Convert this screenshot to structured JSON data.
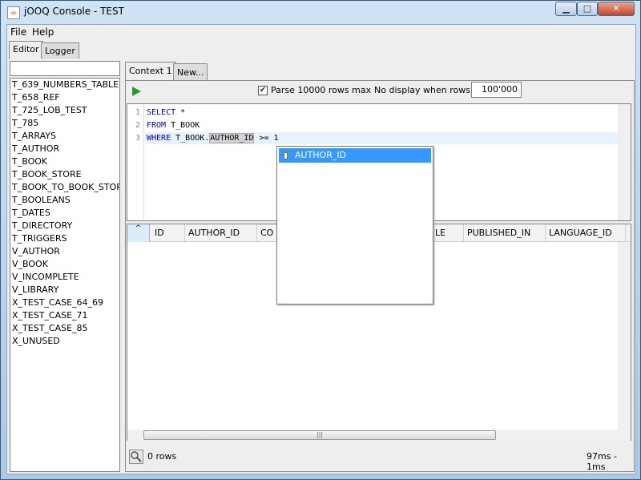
{
  "window": {
    "title": "jOOQ Console - TEST",
    "minimize": "▁",
    "maximize": "□",
    "close": "✕"
  },
  "menu": {
    "file": "File",
    "help": "Help"
  },
  "outer_tabs": {
    "editor": "Editor",
    "logger": "Logger"
  },
  "tables": [
    "T_639_NUMBERS_TABLE",
    "T_658_REF",
    "T_725_LOB_TEST",
    "T_785",
    "T_ARRAYS",
    "T_AUTHOR",
    "T_BOOK",
    "T_BOOK_STORE",
    "T_BOOK_TO_BOOK_STORE",
    "T_BOOLEANS",
    "T_DATES",
    "T_DIRECTORY",
    "T_TRIGGERS",
    "V_AUTHOR",
    "V_BOOK",
    "V_INCOMPLETE",
    "V_LIBRARY",
    "X_TEST_CASE_64_69",
    "X_TEST_CASE_71",
    "X_TEST_CASE_85",
    "X_UNUSED"
  ],
  "inner_tabs": {
    "context1": "Context 1",
    "new": "New..."
  },
  "toolbar": {
    "parse_checked": true,
    "parse_label": "Parse 10000 rows max",
    "no_display_label": "No display when rows >",
    "rows_value": "100'000"
  },
  "editor": {
    "line_numbers": [
      "1",
      "2",
      "3"
    ],
    "line1_kw": "SELECT",
    "line1_rest": " *",
    "line2_kw": "FROM",
    "line2_rest": " T_BOOK",
    "line3_kw": "WHERE",
    "line3_a": " T_BOOK.",
    "line3_hl": "AUTHOR_ID",
    "line3_b": " >= 1"
  },
  "autocomplete": {
    "items": [
      "AUTHOR_ID"
    ]
  },
  "grid": {
    "columns": [
      "ID",
      "AUTHOR_ID",
      "CO",
      "LE",
      "PUBLISHED_IN",
      "LANGUAGE_ID"
    ],
    "corner": "^"
  },
  "status": {
    "rows": "0 rows",
    "time": "97ms - 1ms"
  },
  "colors": {
    "accent_selection": "#3399ff",
    "keyword": "#0000c0",
    "run": "#2a9a2a"
  }
}
